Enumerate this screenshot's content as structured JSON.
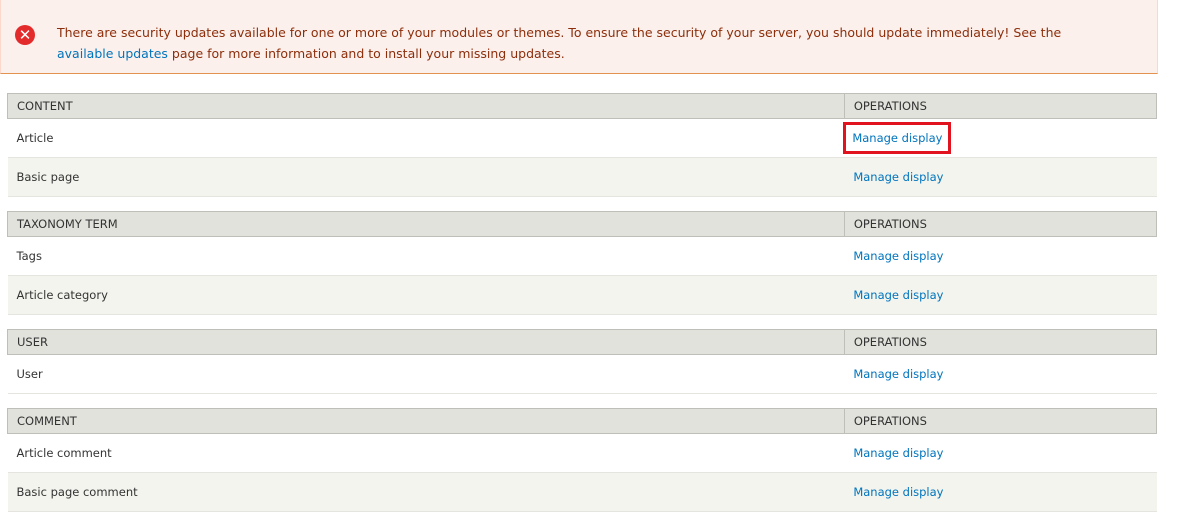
{
  "alert": {
    "text_before": "There are security updates available for one or more of your modules or themes. To ensure the security of your server, you should update immediately! See the",
    "link_text": "available updates",
    "text_after": " page for more information and to install your missing updates."
  },
  "tables": [
    {
      "header": "CONTENT",
      "operations_header": "OPERATIONS",
      "rows": [
        {
          "name": "Article",
          "operation": "Manage display"
        },
        {
          "name": "Basic page",
          "operation": "Manage display"
        }
      ]
    },
    {
      "header": "TAXONOMY TERM",
      "operations_header": "OPERATIONS",
      "rows": [
        {
          "name": "Tags",
          "operation": "Manage display"
        },
        {
          "name": "Article category",
          "operation": "Manage display"
        }
      ]
    },
    {
      "header": "USER",
      "operations_header": "OPERATIONS",
      "rows": [
        {
          "name": "User",
          "operation": "Manage display"
        }
      ]
    },
    {
      "header": "COMMENT",
      "operations_header": "OPERATIONS",
      "rows": [
        {
          "name": "Article comment",
          "operation": "Manage display"
        },
        {
          "name": "Basic page comment",
          "operation": "Manage display"
        }
      ]
    }
  ],
  "icons": {
    "alert_icon": "error-x-icon"
  },
  "colors": {
    "link": "#0074bd",
    "alert_text": "#8c2e0b",
    "highlight": "#e0131f",
    "error_icon": "#e42b2b"
  }
}
